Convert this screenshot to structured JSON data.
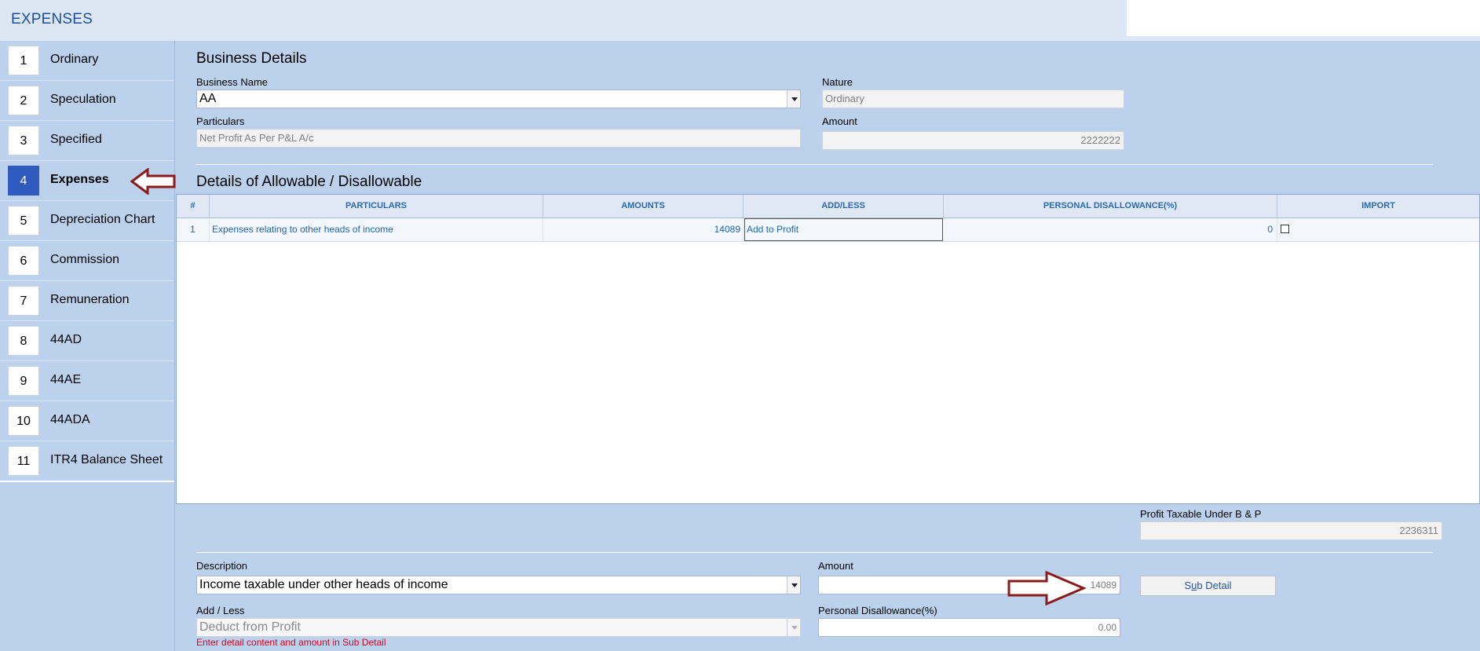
{
  "window": {
    "title": "EXPENSES"
  },
  "sidebar": {
    "items": [
      {
        "num": "1",
        "label": "Ordinary"
      },
      {
        "num": "2",
        "label": "Speculation"
      },
      {
        "num": "3",
        "label": "Specified"
      },
      {
        "num": "4",
        "label": "Expenses",
        "active": true
      },
      {
        "num": "5",
        "label": "Depreciation Chart"
      },
      {
        "num": "6",
        "label": "Commission"
      },
      {
        "num": "7",
        "label": "Remuneration"
      },
      {
        "num": "8",
        "label": "44AD"
      },
      {
        "num": "9",
        "label": "44AE"
      },
      {
        "num": "10",
        "label": "44ADA"
      },
      {
        "num": "11",
        "label": "ITR4 Balance Sheet"
      }
    ]
  },
  "business": {
    "section_title": "Business Details",
    "name_label": "Business Name",
    "name_value": "AA",
    "nature_label": "Nature",
    "nature_value": "Ordinary",
    "particulars_label": "Particulars",
    "particulars_value": "Net Profit As Per P&L A/c",
    "amount_label": "Amount",
    "amount_value": "2222222"
  },
  "details": {
    "section_title": "Details of Allowable / Disallowable",
    "columns": [
      "#",
      "PARTICULARS",
      "AMOUNTS",
      "ADD/LESS",
      "PERSONAL DISALLOWANCE(%)",
      "IMPORT"
    ],
    "rows": [
      {
        "num": "1",
        "particulars": "Expenses relating to other heads of income",
        "amount": "14089",
        "add_less": "Add to Profit",
        "personal": "0",
        "import": false
      }
    ]
  },
  "profit": {
    "label": "Profit Taxable Under B & P",
    "value": "2236311"
  },
  "editor": {
    "description_label": "Description",
    "description_value": "Income taxable under other heads of income",
    "amount_label": "Amount",
    "amount_value": "14089",
    "sub_detail_prefix": "S",
    "sub_detail_underline": "u",
    "sub_detail_suffix": "b Detail",
    "addless_label": "Add / Less",
    "addless_value": "Deduct from Profit",
    "personal_label": "Personal Disallowance(%)",
    "personal_value": "0.00",
    "error_text": "Enter detail content and amount in Sub Detail"
  },
  "colors": {
    "background": "#bcd1ec",
    "accent": "#2e5bbd",
    "arrow": "#8b1a1a",
    "error": "#e0001b",
    "grid_text": "#2166b5"
  }
}
